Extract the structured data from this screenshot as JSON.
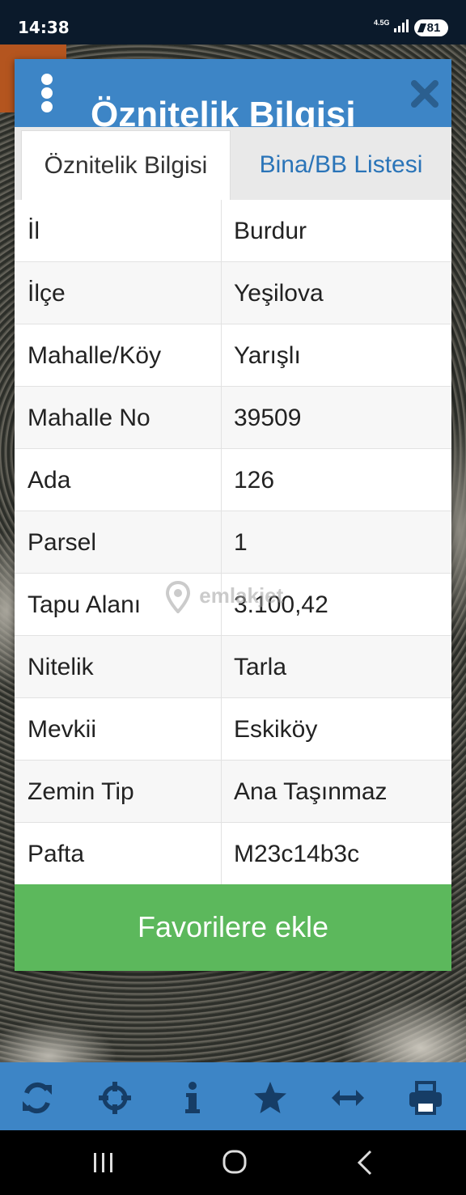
{
  "status_bar": {
    "time": "14:38",
    "network": "4.5G",
    "battery": "81"
  },
  "dialog": {
    "title": "Öznitelik Bilgisi",
    "tabs": [
      {
        "label": "Öznitelik Bilgisi",
        "active": true
      },
      {
        "label": "Bina/BB Listesi",
        "active": false
      }
    ],
    "rows": [
      {
        "key": "İl",
        "value": "Burdur"
      },
      {
        "key": "İlçe",
        "value": "Yeşilova"
      },
      {
        "key": "Mahalle/Köy",
        "value": "Yarışlı"
      },
      {
        "key": "Mahalle No",
        "value": "39509"
      },
      {
        "key": "Ada",
        "value": "126"
      },
      {
        "key": "Parsel",
        "value": "1"
      },
      {
        "key": "Tapu Alanı",
        "value": "3.100,42"
      },
      {
        "key": "Nitelik",
        "value": "Tarla"
      },
      {
        "key": "Mevkii",
        "value": "Eskiköy"
      },
      {
        "key": "Zemin Tip",
        "value": "Ana Taşınmaz"
      },
      {
        "key": "Pafta",
        "value": "M23c14b3c"
      }
    ],
    "favorite_button": "Favorilere ekle"
  },
  "watermark": "emlakjet",
  "toolbar": {
    "icons": [
      "refresh-icon",
      "locate-icon",
      "info-icon",
      "star-icon",
      "measure-icon",
      "print-icon"
    ]
  },
  "colors": {
    "header_blue": "#3d85c6",
    "button_green": "#5cb85c",
    "tab_link_blue": "#2a74b8"
  }
}
